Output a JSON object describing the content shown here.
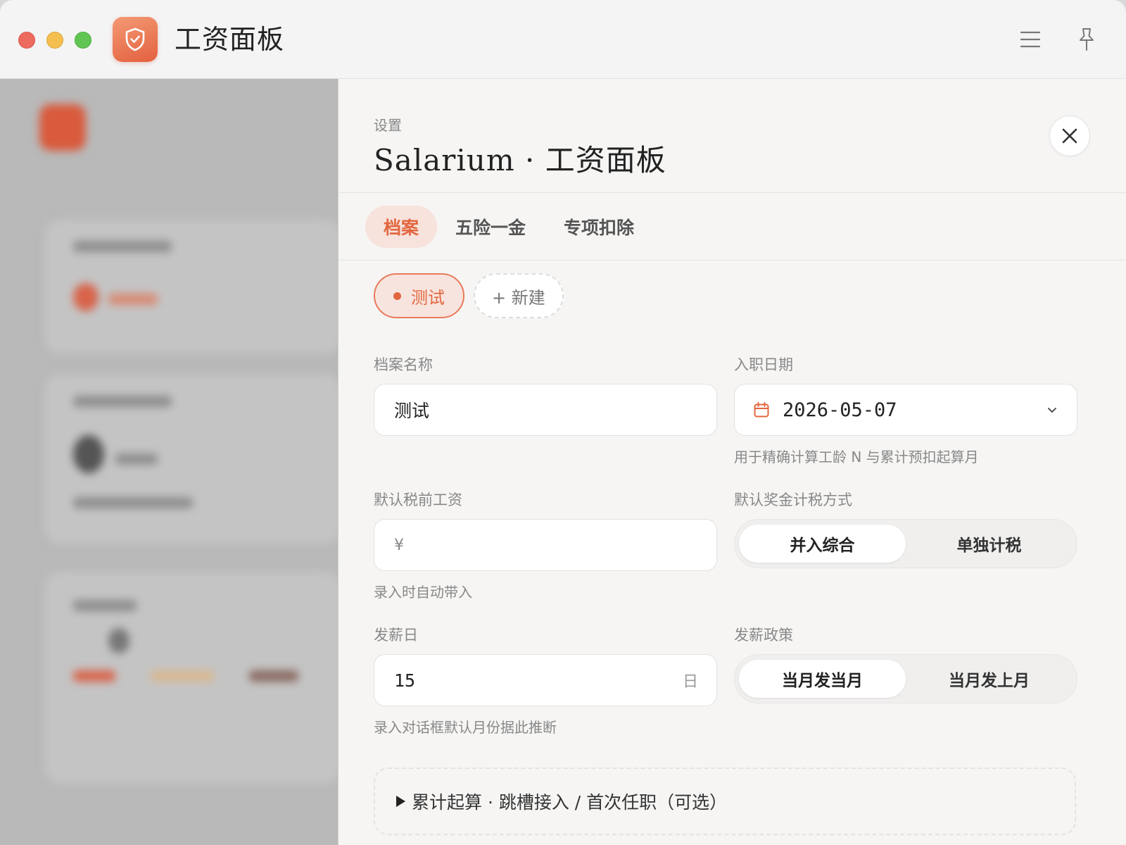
{
  "window": {
    "title": "工资面板"
  },
  "settings": {
    "eyebrow": "设置",
    "title": "Salarium · 工资面板",
    "tabs": [
      {
        "label": "档案",
        "active": true
      },
      {
        "label": "五险一金",
        "active": false
      },
      {
        "label": "专项扣除",
        "active": false
      }
    ],
    "profiles": {
      "active": "测试",
      "new_label": "+ 新建"
    },
    "fields": {
      "profile_name": {
        "label": "档案名称",
        "value": "测试"
      },
      "hire_date": {
        "label": "入职日期",
        "value": "2026-05-07",
        "hint": "用于精确计算工龄 N 与累计预扣起算月"
      },
      "salary": {
        "label": "默认税前工资",
        "prefix": "¥",
        "value": "",
        "hint": "录入时自动带入"
      },
      "bonus_tax": {
        "label": "默认奖金计税方式",
        "options": [
          "并入综合",
          "单独计税"
        ],
        "selected": "并入综合"
      },
      "payday": {
        "label": "发薪日",
        "value": "15",
        "suffix": "日",
        "hint": "录入对话框默认月份据此推断"
      },
      "pay_policy": {
        "label": "发薪政策",
        "options": [
          "当月发当月",
          "当月发上月"
        ],
        "selected": "当月发当月"
      }
    },
    "collapsible": {
      "label": "累计起算 · 跳槽接入 / 首次任职（可选）"
    }
  },
  "colors": {
    "accent": "#e2673f",
    "accent_bg": "#f7e2dc"
  }
}
